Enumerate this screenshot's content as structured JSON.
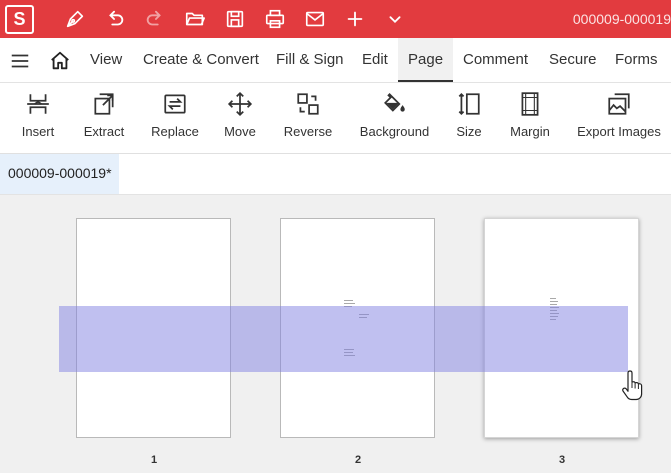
{
  "app": {
    "logo_letter": "S",
    "document_title": "000009-000019"
  },
  "quick_access": [
    "pen-icon",
    "undo-icon",
    "redo-icon",
    "open-folder-icon",
    "save-icon",
    "print-icon",
    "mail-icon",
    "add-icon",
    "chevron-down-icon"
  ],
  "menu": {
    "tabs": [
      "View",
      "Create & Convert",
      "Fill & Sign",
      "Edit",
      "Page",
      "Comment",
      "Secure",
      "Forms"
    ],
    "active_tab": "Page"
  },
  "ribbon": {
    "buttons": [
      {
        "label": "Insert",
        "icon": "insert-icon"
      },
      {
        "label": "Extract",
        "icon": "extract-icon"
      },
      {
        "label": "Replace",
        "icon": "replace-icon"
      },
      {
        "label": "Move",
        "icon": "move-icon"
      },
      {
        "label": "Reverse",
        "icon": "reverse-icon"
      },
      {
        "label": "Background",
        "icon": "paint-bucket-icon"
      },
      {
        "label": "Size",
        "icon": "size-icon"
      },
      {
        "label": "Margin",
        "icon": "margin-icon"
      },
      {
        "label": "Export Images",
        "icon": "export-images-icon"
      }
    ]
  },
  "document_tab": {
    "label": "000009-000019*"
  },
  "pages": [
    {
      "number": "1"
    },
    {
      "number": "2"
    },
    {
      "number": "3",
      "selected": true
    }
  ],
  "colors": {
    "titlebar": "#e23b3f",
    "selection_overlay": "#8282e1",
    "doc_tab_bg": "#e6f0fb"
  }
}
